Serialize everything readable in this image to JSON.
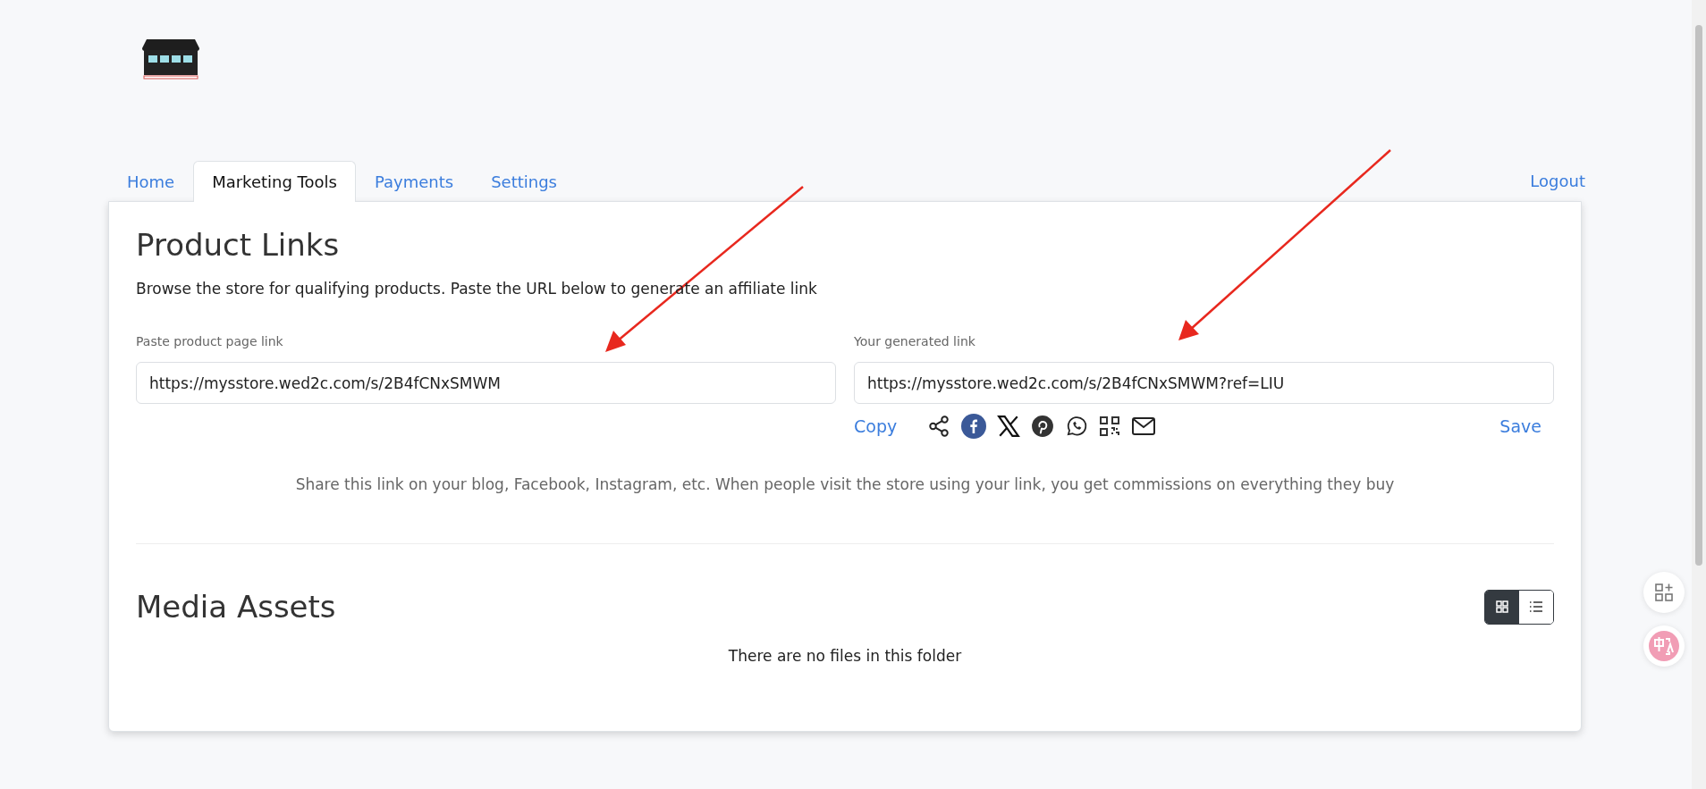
{
  "tabs": [
    {
      "label": "Home",
      "selected": false
    },
    {
      "label": "Marketing Tools",
      "selected": true
    },
    {
      "label": "Payments",
      "selected": false
    },
    {
      "label": "Settings",
      "selected": false
    }
  ],
  "logout": "Logout",
  "product_links": {
    "title": "Product Links",
    "description": "Browse the store for qualifying products. Paste the URL below to generate an affiliate link",
    "source_field": {
      "label": "Paste product page link",
      "value": "https://mysstore.wed2c.com/s/2B4fCNxSMWM"
    },
    "generated_field": {
      "label": "Your generated link",
      "value": "https://mysstore.wed2c.com/s/2B4fCNxSMWM?ref=LIU"
    },
    "copy": "Copy",
    "save": "Save",
    "share_note": "Share this link on your blog, Facebook, Instagram, etc. When people visit the store using your link, you get commissions on everything they buy"
  },
  "media_assets": {
    "title": "Media Assets",
    "view_toggle": [
      {
        "kind": "grid",
        "selected": true
      },
      {
        "kind": "list",
        "selected": false
      }
    ],
    "empty_message": "There are no files in this folder"
  }
}
